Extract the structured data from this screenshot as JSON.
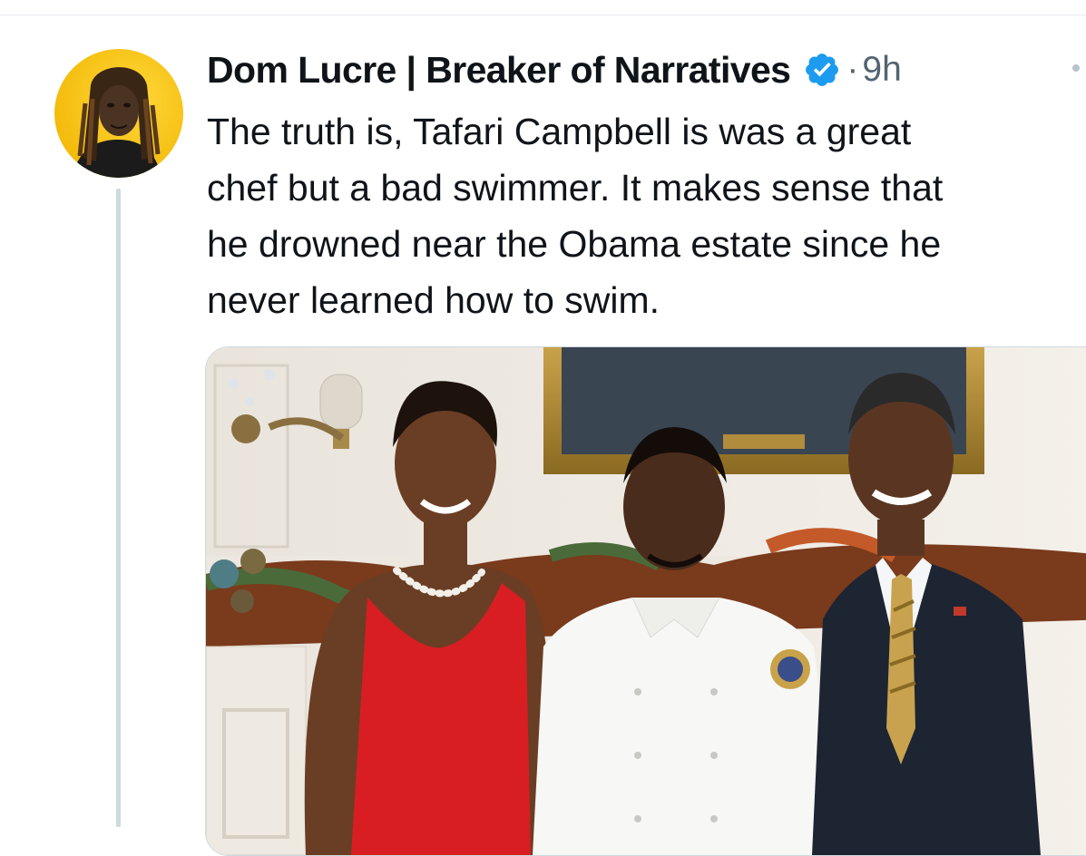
{
  "tweet": {
    "author_name": "Dom Lucre | Breaker of Narratives",
    "separator": "·",
    "timestamp": "9h",
    "text_lines": [
      "The truth is, Tafari Campbell is was a great",
      "chef but a bad swimmer. It makes sense that",
      "he drowned near the Obama estate since he",
      "never learned how to swim."
    ],
    "icons": {
      "verified": "verified-badge-icon",
      "more": "more-options-icon"
    },
    "colors": {
      "verified": "#1d9bf0",
      "text": "#0f1419",
      "muted": "#536471",
      "avatar_bg": "#f5c518"
    }
  }
}
